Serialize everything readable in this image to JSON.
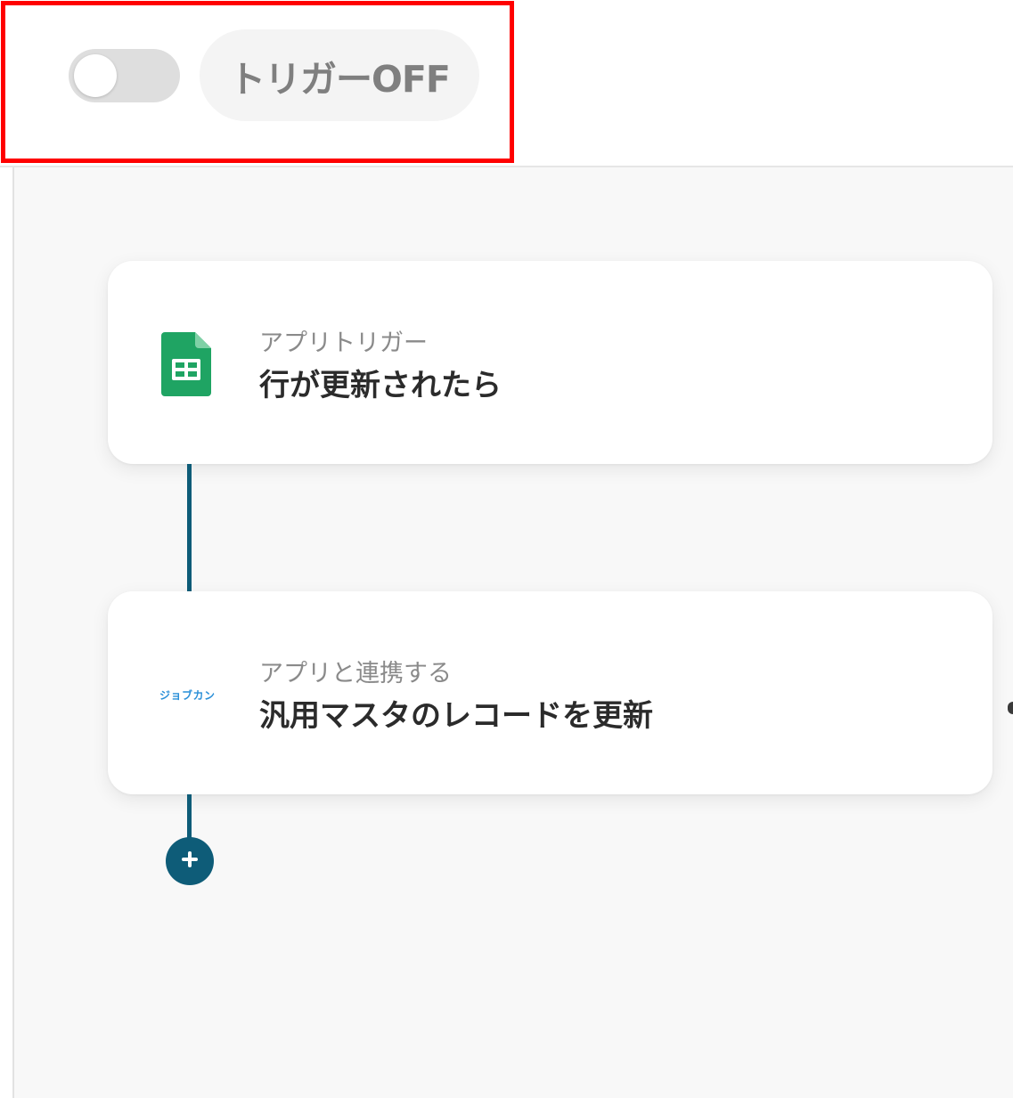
{
  "header": {
    "toggle": {
      "state": "off"
    },
    "status_label": "トリガーOFF"
  },
  "flow": {
    "steps": [
      {
        "type_label": "アプリトリガー",
        "title": "行が更新されたら",
        "icon": "google-sheets-icon"
      },
      {
        "type_label": "アプリと連携する",
        "title": "汎用マスタのレコードを更新",
        "icon": "jobcan-logo",
        "logo_text": "ジョブカン"
      }
    ],
    "add_icon": "plus-icon"
  },
  "colors": {
    "highlight": "#ff0000",
    "connector": "#0e5c78",
    "toggle_track": "#dedede",
    "status_pill_bg": "#f4f4f4",
    "status_text": "#7f7f7f",
    "sheets_green": "#1fa463",
    "jobcan_blue": "#2a8fd8"
  }
}
